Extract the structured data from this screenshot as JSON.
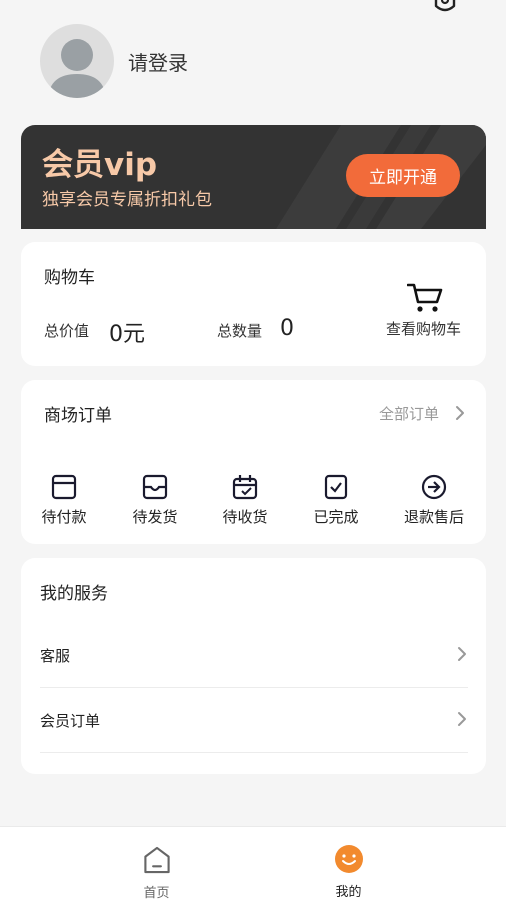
{
  "profile": {
    "login_text": "请登录"
  },
  "vip": {
    "title": "会员vip",
    "subtitle": "独享会员专属折扣礼包",
    "button_label": "立即开通",
    "text_color": "#f7c9a8",
    "button_color": "#f26b3a",
    "card_color": "#333333"
  },
  "cart": {
    "title": "购物车",
    "total_price_label": "总价值",
    "total_price_value": "0元",
    "total_qty_label": "总数量",
    "total_qty_value": "0",
    "view_cart_label": "查看购物车",
    "icon": "cart-icon"
  },
  "orders": {
    "title": "商场订单",
    "all_orders_label": "全部订单",
    "items": [
      {
        "label": "待付款",
        "icon": "wallet-icon"
      },
      {
        "label": "待发货",
        "icon": "inbox-icon"
      },
      {
        "label": "待收货",
        "icon": "calendar-check-icon"
      },
      {
        "label": "已完成",
        "icon": "checkbox-icon"
      },
      {
        "label": "退款售后",
        "icon": "arrow-circle-icon"
      }
    ]
  },
  "services": {
    "title": "我的服务",
    "rows": [
      {
        "label": "客服"
      },
      {
        "label": "会员订单"
      }
    ]
  },
  "tabbar": {
    "tabs": [
      {
        "label": "首页",
        "icon": "home-icon",
        "active": false
      },
      {
        "label": "我的",
        "icon": "smile-icon",
        "active": true
      }
    ],
    "active_color": "#f28a2e",
    "inactive_color": "#666666"
  }
}
